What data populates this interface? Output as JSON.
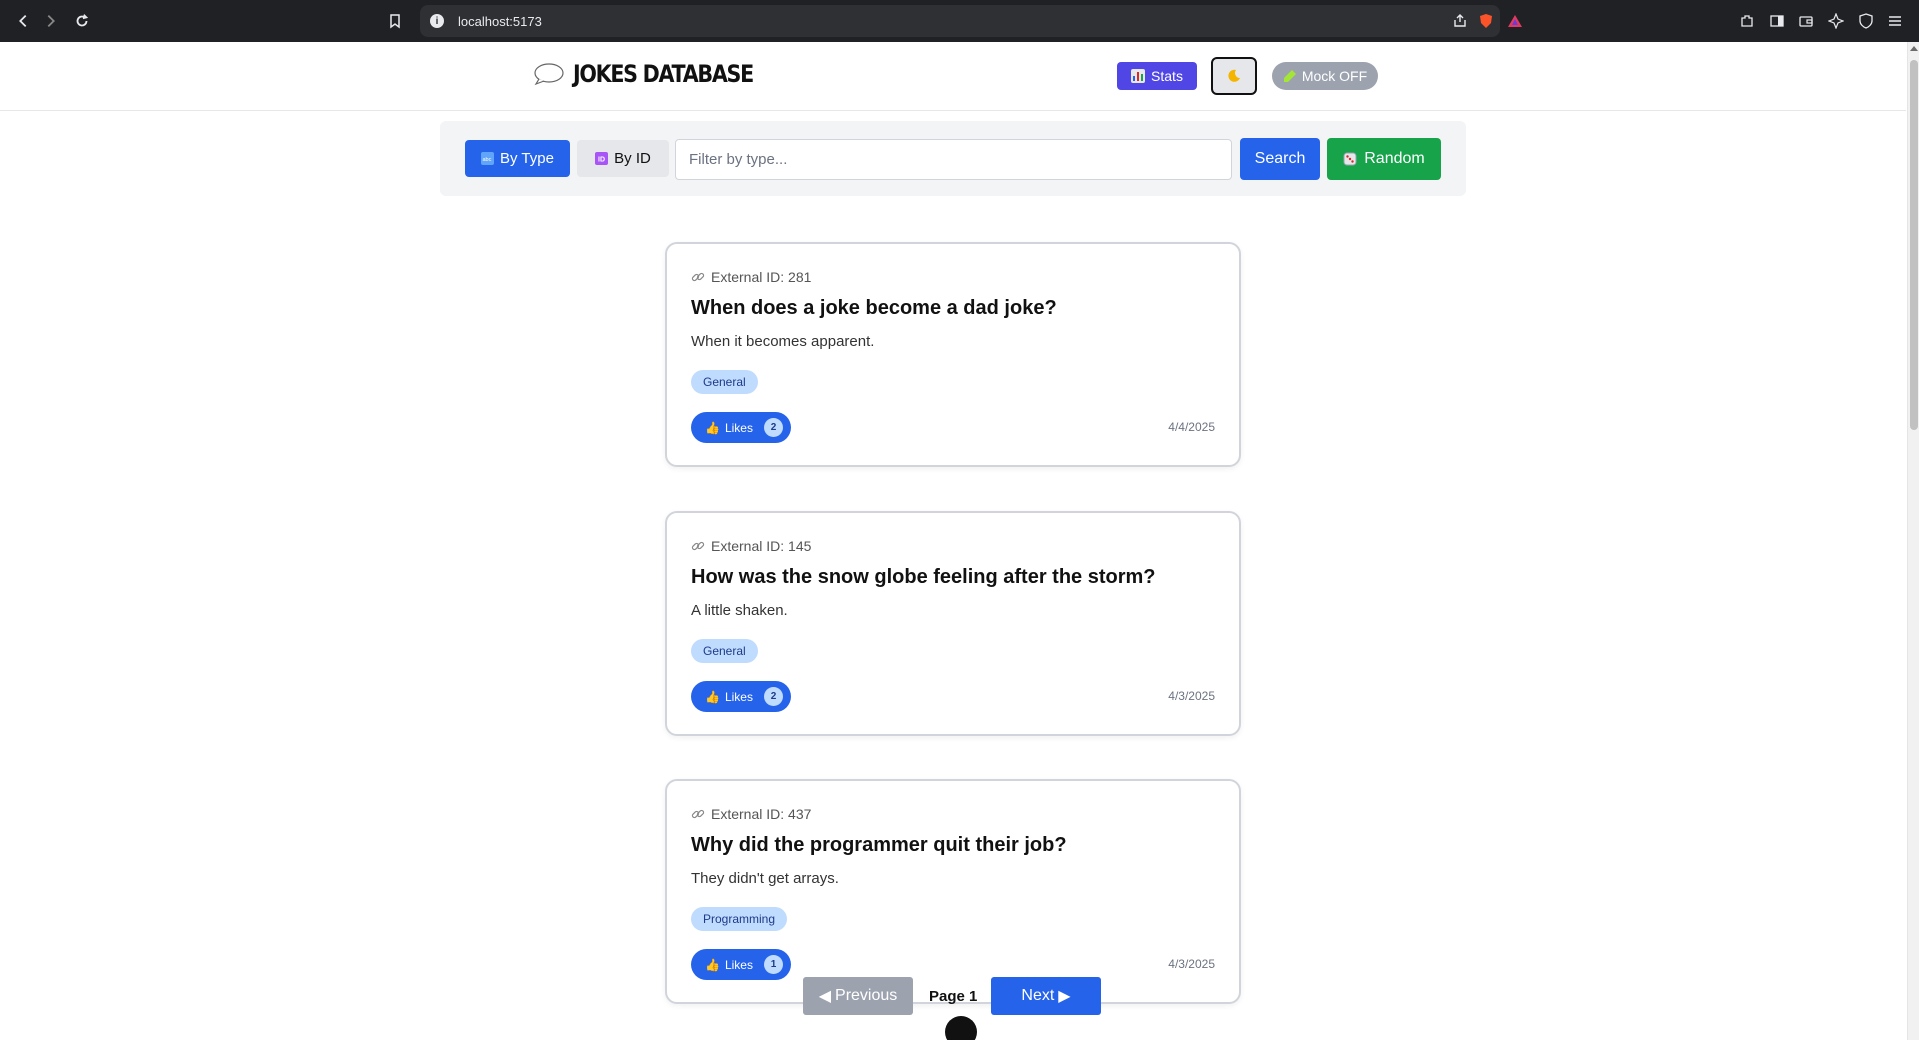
{
  "browser": {
    "url": "localhost:5173"
  },
  "header": {
    "title": "JOKES DATABASE",
    "stats_label": "Stats",
    "mock_label": "Mock OFF"
  },
  "search": {
    "by_type_label": "By Type",
    "by_id_label": "By ID",
    "placeholder": "Filter by type...",
    "search_label": "Search",
    "random_label": "Random"
  },
  "jokes": [
    {
      "external_id": "External ID: 281",
      "setup": "When does a joke become a dad joke?",
      "punchline": "When it becomes apparent.",
      "type": "General",
      "likes_label": "Likes",
      "likes": "2",
      "date": "4/4/2025"
    },
    {
      "external_id": "External ID: 145",
      "setup": "How was the snow globe feeling after the storm?",
      "punchline": "A little shaken.",
      "type": "General",
      "likes_label": "Likes",
      "likes": "2",
      "date": "4/3/2025"
    },
    {
      "external_id": "External ID: 437",
      "setup": "Why did the programmer quit their job?",
      "punchline": "They didn't get arrays.",
      "type": "Programming",
      "likes_label": "Likes",
      "likes": "1",
      "date": "4/3/2025"
    }
  ],
  "pagination": {
    "prev_label": "Previous",
    "page_label": "Page 1",
    "next_label": "Next"
  },
  "colors": {
    "primary": "#2563eb",
    "stats": "#4f46e5",
    "random": "#16a34a",
    "disabled": "#9ca3af",
    "tag_bg": "#bfdbfe"
  }
}
